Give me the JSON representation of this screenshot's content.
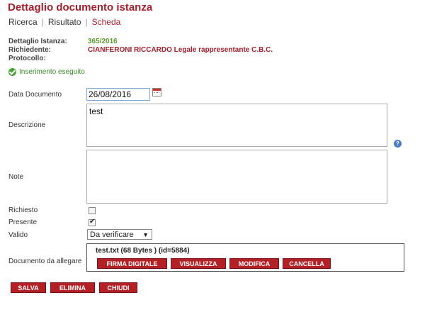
{
  "header": {
    "title": "Dettaglio documento istanza"
  },
  "nav": {
    "items": [
      "Ricerca",
      "Risultato",
      "Scheda"
    ],
    "separator": "|"
  },
  "meta": {
    "istanza_label": "Dettaglio Istanza:",
    "istanza_value": "365/2016",
    "richiedente_label": "Richiedente:",
    "richiedente_value": "CIANFERONI RICCARDO Legale rappresentante C.B.C.",
    "protocollo_label": "Protocollo:",
    "protocollo_value": ""
  },
  "status": {
    "message": "Inserimento eseguito",
    "icon": "success-check-icon"
  },
  "form": {
    "data_documento_label": "Data Documento",
    "data_documento_value": "26/08/2016",
    "descrizione_label": "Descrizione",
    "descrizione_value": "test",
    "note_label": "Note",
    "note_value": "",
    "richiesto_label": "Richiesto",
    "richiesto_checked": false,
    "presente_label": "Presente",
    "presente_checked": true,
    "valido_label": "Valido",
    "valido_value": "Da verificare",
    "allegato_label": "Documento da allegare"
  },
  "attachment": {
    "file_info": "test.txt (68 Bytes ) (id=5884)",
    "buttons": [
      "FIRMA DIGITALE",
      "VISUALIZZA",
      "MODIFICA",
      "CANCELLA"
    ]
  },
  "actions": {
    "save": "SALVA",
    "delete": "ELIMINA",
    "close": "CHIUDI"
  },
  "colors": {
    "brand": "#a0202b",
    "button": "#b22126",
    "success": "#3c8a2e",
    "number": "#5a9a2f"
  }
}
